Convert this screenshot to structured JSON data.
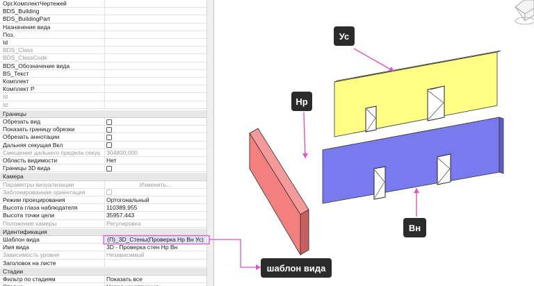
{
  "properties": {
    "rows_top": [
      {
        "key": "Орг.КомплектЧертежей",
        "type": "text",
        "value": "",
        "disabled": false
      },
      {
        "key": "BDS_Building",
        "type": "text",
        "value": "",
        "disabled": false
      },
      {
        "key": "BDS_BuildingPart",
        "type": "text",
        "value": "",
        "disabled": false
      },
      {
        "key": "Назначение вида",
        "type": "text",
        "value": "",
        "disabled": false
      },
      {
        "key": "Поз.",
        "type": "text",
        "value": "",
        "disabled": false
      },
      {
        "key": "Id",
        "type": "text",
        "value": "",
        "disabled": false
      },
      {
        "key": "BDS_Class",
        "type": "text",
        "value": "",
        "disabled": true
      },
      {
        "key": "BDS_ClassCode",
        "type": "text",
        "value": "",
        "disabled": true
      },
      {
        "key": "BDS_Обозначение вида",
        "type": "text",
        "value": "",
        "disabled": false
      },
      {
        "key": "BS_Текст",
        "type": "text",
        "value": "",
        "disabled": false
      },
      {
        "key": "Комплект",
        "type": "text",
        "value": "",
        "disabled": false
      },
      {
        "key": "Комплект Р",
        "type": "text",
        "value": "",
        "disabled": false
      },
      {
        "key": "Id",
        "type": "text",
        "value": "",
        "disabled": true
      },
      {
        "key": "Id",
        "type": "text",
        "value": "",
        "disabled": true
      }
    ],
    "group_bounds": {
      "title": "Границы",
      "rows": [
        {
          "key": "Обрезать вид",
          "type": "check",
          "value": "",
          "disabled": false
        },
        {
          "key": "Показать границу обрезки",
          "type": "check",
          "value": "",
          "disabled": false
        },
        {
          "key": "Обрезать аннотации",
          "type": "check",
          "value": "",
          "disabled": false
        },
        {
          "key": "Дальняя секущая Вкл",
          "type": "check",
          "value": "",
          "disabled": false
        },
        {
          "key": "Смещение дальнего предела секущего ...",
          "type": "text",
          "value": "304800,000",
          "disabled": true
        },
        {
          "key": "Область видимости",
          "type": "text",
          "value": "Нет",
          "disabled": false
        },
        {
          "key": "Границы 3D вида",
          "type": "check",
          "value": "",
          "disabled": false
        }
      ]
    },
    "group_camera": {
      "title": "Камера",
      "rows": [
        {
          "key": "Параметры визуализации",
          "type": "button",
          "value": "Изменить...",
          "disabled": true
        },
        {
          "key": "Заблокированная ориентация",
          "type": "check",
          "value": "",
          "disabled": true
        },
        {
          "key": "Режим проецирования",
          "type": "text",
          "value": "Ортогональный",
          "disabled": false
        },
        {
          "key": "Высота глаза наблюдателя",
          "type": "text",
          "value": "110389,955",
          "disabled": false
        },
        {
          "key": "Высота точки цели",
          "type": "text",
          "value": "35957,443",
          "disabled": false
        },
        {
          "key": "Положение камеры",
          "type": "text",
          "value": "Регулировка",
          "disabled": true
        }
      ]
    },
    "group_identity": {
      "title": "Идентификация",
      "rows": [
        {
          "key": "Шаблон вида",
          "type": "button",
          "value": "(П)_3D_Стены(Проверка Нр Вн Ус)",
          "disabled": false,
          "selected": true
        },
        {
          "key": "Имя вида",
          "type": "text",
          "value": "3D - Проверка стен Нр Вн",
          "disabled": false
        },
        {
          "key": "Зависимость уровня",
          "type": "text",
          "value": "Независимый",
          "disabled": true
        },
        {
          "key": "Заголовок на листе",
          "type": "text",
          "value": "",
          "disabled": false
        }
      ]
    },
    "group_stages": {
      "title": "Стадии",
      "rows": [
        {
          "key": "Фильтр по стадиям",
          "type": "text",
          "value": "Показать все",
          "disabled": false
        },
        {
          "key": "Стадия",
          "type": "text",
          "value": "Новая конструкция",
          "disabled": false
        }
      ]
    }
  },
  "callouts": {
    "us": "Ус",
    "nr": "Нр",
    "vn": "Вн",
    "template": "шаблон вида"
  },
  "colors": {
    "wall_us": "#ffff86",
    "wall_vn": "#7a7aef",
    "wall_nr": "#f37f7f",
    "arrow": "#e052c8",
    "callout_bg": "#2b2b2b"
  }
}
